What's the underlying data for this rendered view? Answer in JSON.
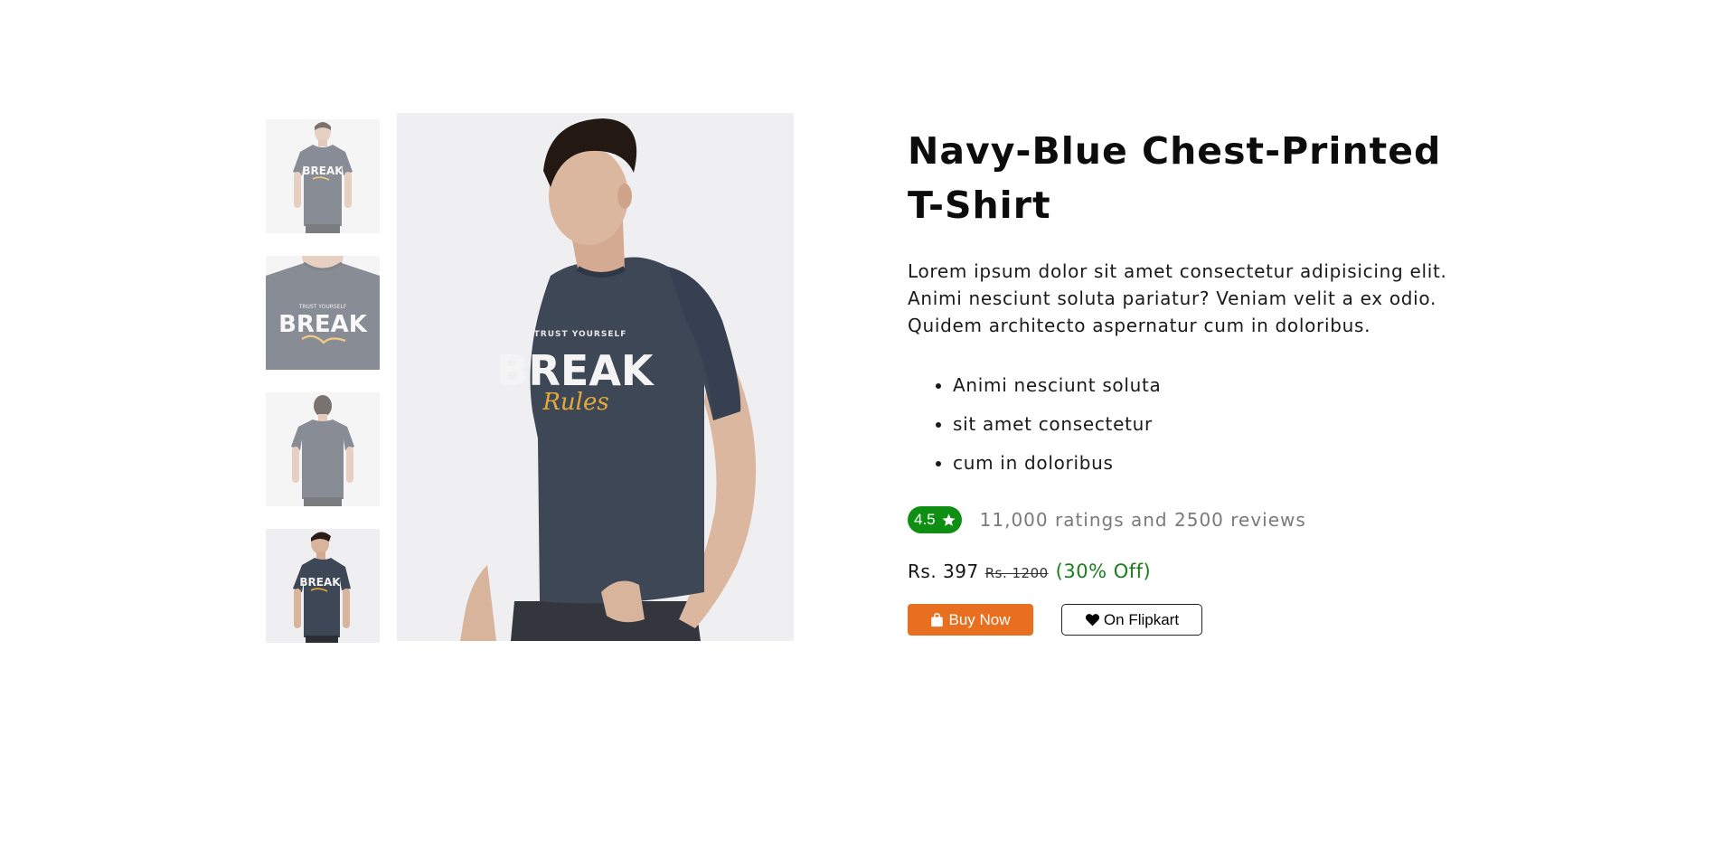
{
  "product": {
    "title": "Navy-Blue Chest-Printed T-Shirt",
    "description": "Lorem ipsum dolor sit amet consectetur adipisicing elit. Animi nesciunt soluta pariatur? Veniam velit a ex odio. Quidem architecto aspernatur cum in doloribus.",
    "features": [
      "Animi nesciunt soluta",
      "sit amet consectetur",
      "cum in doloribus"
    ],
    "rating": "4.5",
    "reviews_text": "11,000 ratings and 2500 reviews",
    "price_current": "Rs. 397",
    "price_old": "Rs. 1200",
    "price_off": "(30% Off)"
  },
  "gallery": {
    "thumbnails": [
      {
        "view": "front",
        "print_text": "BREAK"
      },
      {
        "view": "chest-closeup",
        "print_text": "BREAK"
      },
      {
        "view": "back"
      },
      {
        "view": "side",
        "print_text": "BREAK"
      }
    ],
    "main_print": {
      "tagline": "TRUST YOURSELF",
      "headline": "BREAK",
      "script": "Rules"
    }
  },
  "actions": {
    "buy_label": "Buy Now",
    "flipkart_label": "On Flipkart"
  },
  "icons": {
    "rating": "star-icon",
    "buy": "shopping-bag-icon",
    "flipkart": "heart-icon"
  },
  "colors": {
    "accent_orange": "#e76f1f",
    "rating_green": "#0e8f14",
    "discount_green": "#1a7d1e",
    "shirt_navy": "#3e4755",
    "image_background": "#efeff1"
  }
}
